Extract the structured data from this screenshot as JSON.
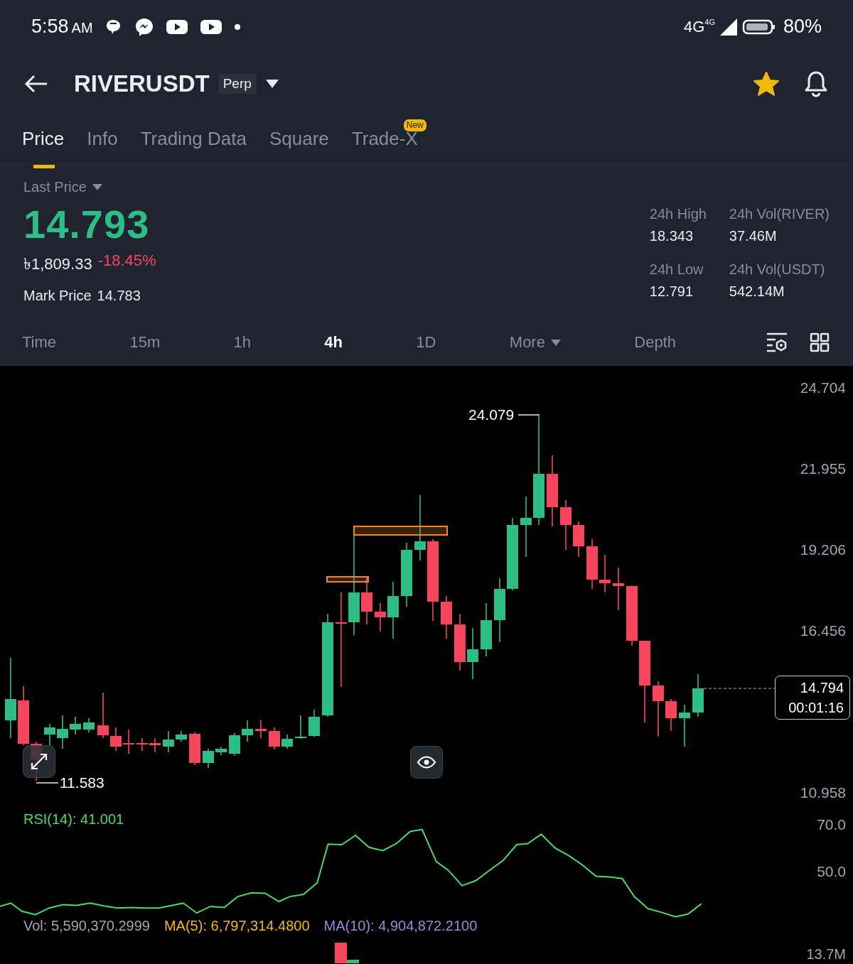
{
  "status_bar": {
    "time": "5:58",
    "meridiem": "AM",
    "network": "4G",
    "network_secondary": "4G",
    "battery": "80%"
  },
  "header": {
    "symbol": "RIVERUSDT",
    "badge": "Perp",
    "favorite": true
  },
  "tabs": [
    {
      "label": "Price",
      "selected": true
    },
    {
      "label": "Info",
      "selected": false
    },
    {
      "label": "Trading Data",
      "selected": false
    },
    {
      "label": "Square",
      "selected": false
    },
    {
      "label": "Trade-X",
      "selected": false,
      "badge": "New"
    }
  ],
  "price": {
    "label": "Last Price",
    "value": "14.793",
    "fiat": "৳1,809.33",
    "change": "-18.45%",
    "mark_label": "Mark Price",
    "mark_value": "14.783"
  },
  "stats": [
    {
      "label": "24h High",
      "value": "18.343"
    },
    {
      "label": "24h Vol(RIVER)",
      "value": "37.46M"
    },
    {
      "label": "24h Low",
      "value": "12.791"
    },
    {
      "label": "24h Vol(USDT)",
      "value": "542.14M"
    }
  ],
  "intervals": [
    {
      "label": "Time",
      "selected": false,
      "menu": false
    },
    {
      "label": "15m",
      "selected": false,
      "menu": false
    },
    {
      "label": "1h",
      "selected": false,
      "menu": false
    },
    {
      "label": "4h",
      "selected": true,
      "menu": false
    },
    {
      "label": "1D",
      "selected": false,
      "menu": false
    },
    {
      "label": "More",
      "selected": false,
      "menu": true
    },
    {
      "label": "Depth",
      "selected": false,
      "menu": false
    }
  ],
  "chart": {
    "price_axis": [
      "24.704",
      "21.955",
      "19.206",
      "16.456",
      "10.958"
    ],
    "high_label": "24.079",
    "low_label": "11.583",
    "current_price": "14.794",
    "countdown": "00:01:16",
    "rsi_label": "RSI(14): 41.001",
    "rsi_axis": [
      "70.0",
      "50.0"
    ],
    "volume_label": "Vol: 5,590,370.2999",
    "ma5_label": "MA(5): 6,797,314.4800",
    "ma10_label": "MA(10): 4,904,872.2100",
    "volume_axis": "13.7M"
  }
}
